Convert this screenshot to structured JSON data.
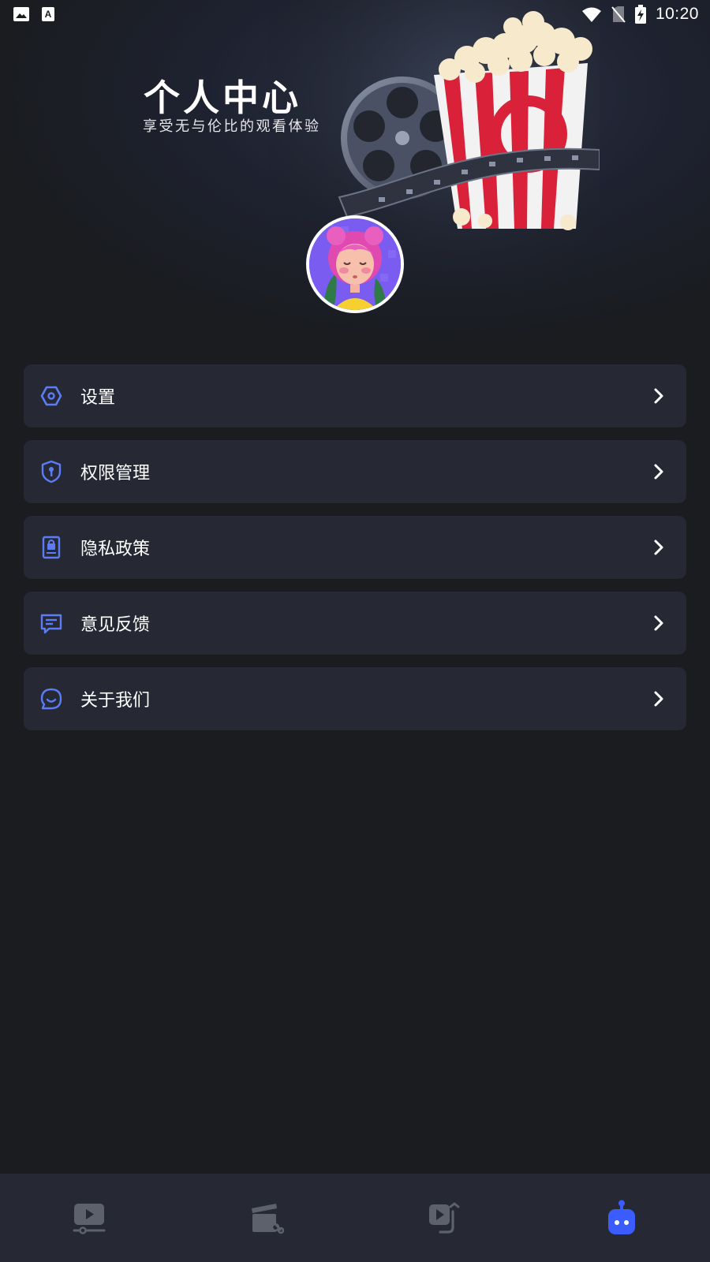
{
  "status_bar": {
    "time": "10:20",
    "icons_left": [
      "gallery-icon",
      "keyboard-a-icon"
    ],
    "icons_right": [
      "wifi-icon",
      "no-sim-icon",
      "battery-charging-icon"
    ]
  },
  "header": {
    "title": "个人中心",
    "subtitle": "享受无与伦比的观看体验"
  },
  "menu": {
    "items": [
      {
        "label": "设置",
        "icon": "settings-icon"
      },
      {
        "label": "权限管理",
        "icon": "shield-icon"
      },
      {
        "label": "隐私政策",
        "icon": "privacy-lock-icon"
      },
      {
        "label": "意见反馈",
        "icon": "feedback-message-icon"
      },
      {
        "label": "关于我们",
        "icon": "smiley-chat-icon"
      }
    ]
  },
  "bottom_nav": {
    "items": [
      {
        "icon": "video-play-icon",
        "active": false
      },
      {
        "icon": "clapper-edit-icon",
        "active": false
      },
      {
        "icon": "video-convert-icon",
        "active": false
      },
      {
        "icon": "robot-profile-icon",
        "active": true
      }
    ]
  },
  "colors": {
    "background": "#1a1c20",
    "card": "#262933",
    "accent": "#3b5cff",
    "icon_blue": "#5b7cf5",
    "nav_inactive": "#5d616b"
  }
}
